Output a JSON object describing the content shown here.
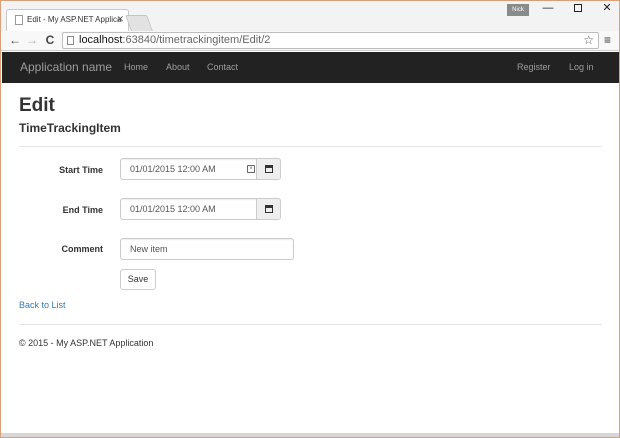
{
  "browser": {
    "tab_title": "Edit - My ASP.NET Applica",
    "tab_close": "✕",
    "user_badge": "Nick",
    "window_minimize": "—",
    "window_close": "✕",
    "nav_back": "←",
    "nav_forward": "→",
    "nav_reload": "C",
    "url_host": "localhost",
    "url_rest": ":63840/timetrackingitem/Edit/2",
    "star": "☆",
    "menu": "≡"
  },
  "navbar": {
    "brand": "Application name",
    "links": [
      "Home",
      "About",
      "Contact"
    ],
    "right_links": [
      "Register",
      "Log in"
    ]
  },
  "page": {
    "title": "Edit",
    "subtitle": "TimeTrackingItem"
  },
  "form": {
    "start_time": {
      "label": "Start Time",
      "value": "01/01/2015 12:00 AM"
    },
    "end_time": {
      "label": "End Time",
      "value": "01/01/2015 12:00 AM"
    },
    "comment": {
      "label": "Comment",
      "value": "New item"
    },
    "save_label": "Save"
  },
  "back_link": "Back to List",
  "footer": "© 2015 - My ASP.NET Application"
}
